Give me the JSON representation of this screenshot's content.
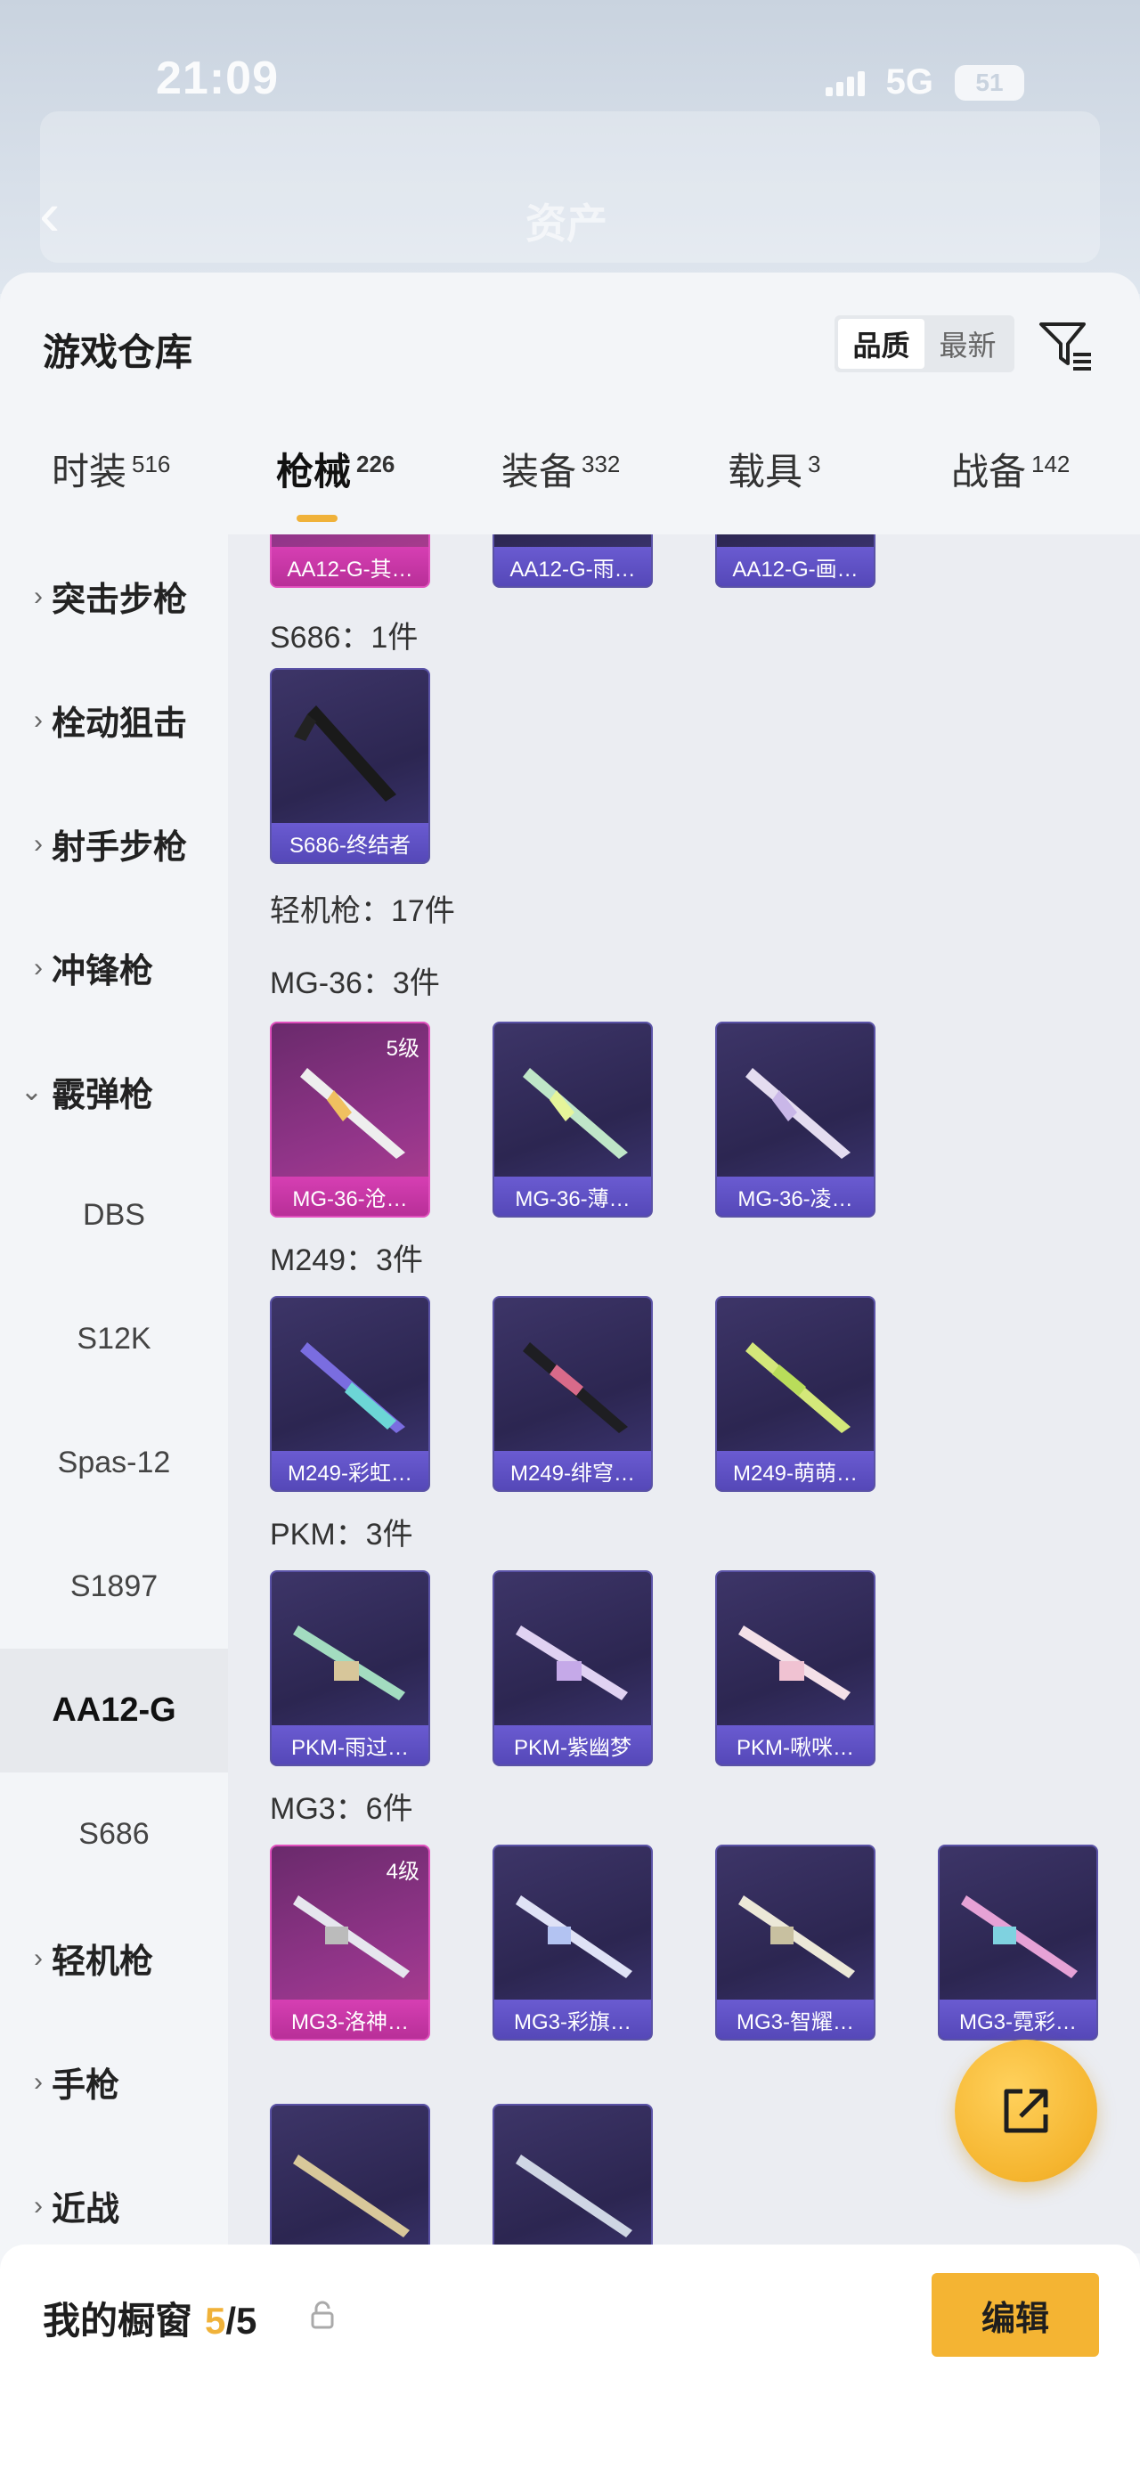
{
  "status": {
    "time": "21:09",
    "network": "5G",
    "battery": "51"
  },
  "background": {
    "title": "资产"
  },
  "sheet": {
    "title": "游戏仓库",
    "sort": {
      "options": [
        "品质",
        "最新"
      ],
      "active": "品质"
    }
  },
  "tabs": [
    {
      "label": "时装",
      "count": "516"
    },
    {
      "label": "枪械",
      "count": "226",
      "active": true
    },
    {
      "label": "装备",
      "count": "332"
    },
    {
      "label": "载具",
      "count": "3"
    },
    {
      "label": "战备",
      "count": "142"
    }
  ],
  "sidebar": {
    "items": [
      {
        "label": "突击步枪",
        "type": "category"
      },
      {
        "label": "栓动狙击",
        "type": "category"
      },
      {
        "label": "射手步枪",
        "type": "category"
      },
      {
        "label": "冲锋枪",
        "type": "category"
      },
      {
        "label": "霰弹枪",
        "type": "category",
        "expanded": true
      },
      {
        "label": "DBS",
        "type": "sub"
      },
      {
        "label": "S12K",
        "type": "sub"
      },
      {
        "label": "Spas-12",
        "type": "sub"
      },
      {
        "label": "S1897",
        "type": "sub"
      },
      {
        "label": "AA12-G",
        "type": "sub",
        "selected": true
      },
      {
        "label": "S686",
        "type": "sub"
      },
      {
        "label": "轻机枪",
        "type": "category"
      },
      {
        "label": "手枪",
        "type": "category"
      },
      {
        "label": "近战",
        "type": "category"
      }
    ]
  },
  "content": {
    "top_cards": [
      {
        "name": "AA12-G-其…",
        "rarity": "pink"
      },
      {
        "name": "AA12-G-雨…",
        "rarity": "purple"
      },
      {
        "name": "AA12-G-画…",
        "rarity": "purple"
      }
    ],
    "s686_label": "S686：1件",
    "s686_cards": [
      {
        "name": "S686-终结者",
        "rarity": "purple"
      }
    ],
    "lmg_label": "轻机枪：17件",
    "mg36_label": "MG-36：3件",
    "mg36_cards": [
      {
        "name": "MG-36-沧…",
        "rarity": "pink",
        "level": "5级"
      },
      {
        "name": "MG-36-薄…",
        "rarity": "purple"
      },
      {
        "name": "MG-36-凌…",
        "rarity": "purple"
      }
    ],
    "m249_label": "M249：3件",
    "m249_cards": [
      {
        "name": "M249-彩虹…",
        "rarity": "purple"
      },
      {
        "name": "M249-绯穹…",
        "rarity": "purple"
      },
      {
        "name": "M249-萌萌…",
        "rarity": "purple"
      }
    ],
    "pkm_label": "PKM：3件",
    "pkm_cards": [
      {
        "name": "PKM-雨过…",
        "rarity": "purple"
      },
      {
        "name": "PKM-紫幽梦",
        "rarity": "purple"
      },
      {
        "name": "PKM-啾咪…",
        "rarity": "purple"
      }
    ],
    "mg3_label": "MG3：6件",
    "mg3_cards": [
      {
        "name": "MG3-洛神…",
        "rarity": "pink",
        "level": "4级"
      },
      {
        "name": "MG3-彩旗…",
        "rarity": "purple"
      },
      {
        "name": "MG3-智耀…",
        "rarity": "purple"
      },
      {
        "name": "MG3-霓彩…",
        "rarity": "purple"
      }
    ]
  },
  "showcase": {
    "label": "我的橱窗",
    "current": "5",
    "total": "/5",
    "edit_label": "编辑"
  },
  "colors": {
    "accent": "#f4b433",
    "rare_pink": "#c23aa2",
    "rare_purple": "#5a52a6"
  }
}
